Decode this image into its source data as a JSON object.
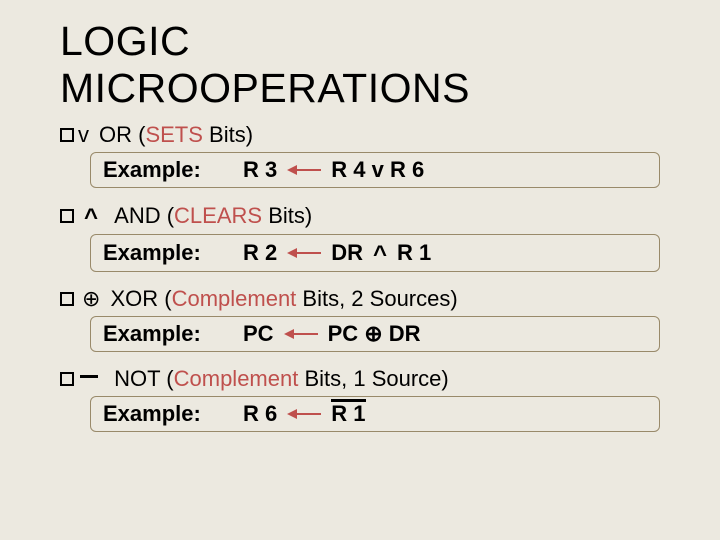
{
  "title_line1": "LOGIC",
  "title_line2": "MICROOPERATIONS",
  "items": [
    {
      "symbol": "v",
      "op_name": "OR",
      "op_desc_pre": " (",
      "op_keyword": "SETS",
      "op_desc_post": " Bits)",
      "example_label": "Example:",
      "dest": "R 3",
      "expr": "R 4 v R 6"
    },
    {
      "symbol": "^",
      "op_name": "AND",
      "op_desc_pre": " (",
      "op_keyword": "CLEARS",
      "op_desc_post": " Bits)",
      "example_label": "Example:",
      "dest": "R 2",
      "expr_l": "DR",
      "expr_mid": "^",
      "expr_r": "R 1"
    },
    {
      "symbol": "⊕",
      "op_name": "XOR",
      "op_desc_pre": " (",
      "op_keyword": "Complement",
      "op_desc_post": " Bits, 2 Sources)",
      "example_label": "Example:",
      "dest": "PC",
      "expr": "PC ⊕ DR"
    },
    {
      "op_name": "NOT",
      "op_desc_pre": " (",
      "op_keyword": "Complement",
      "op_desc_post": " Bits, 1 Source)",
      "example_label": "Example:",
      "dest": "R 6",
      "expr": "R 1"
    }
  ]
}
